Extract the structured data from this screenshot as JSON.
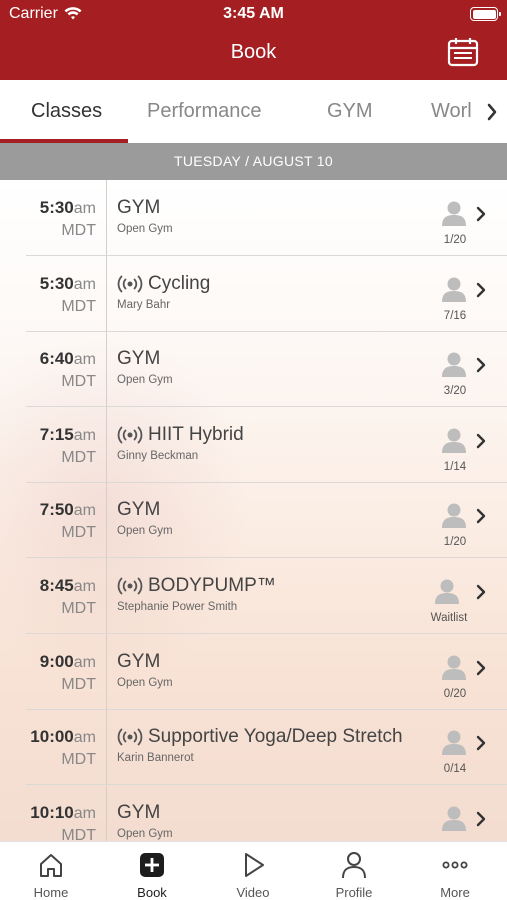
{
  "status": {
    "carrier": "Carrier",
    "time": "3:45 AM"
  },
  "header": {
    "title": "Book"
  },
  "tabs": [
    {
      "label": "Classes",
      "active": true
    },
    {
      "label": "Performance"
    },
    {
      "label": "GYM"
    },
    {
      "label": "Worl"
    }
  ],
  "date": "TUESDAY / AUGUST 10",
  "classes": [
    {
      "time": "5:30",
      "ampm": "am",
      "tz": "MDT",
      "name": "GYM",
      "sub": "Open Gym",
      "live": false,
      "count": "1/20"
    },
    {
      "time": "5:30",
      "ampm": "am",
      "tz": "MDT",
      "name": "Cycling",
      "sub": "Mary Bahr",
      "live": true,
      "count": "7/16"
    },
    {
      "time": "6:40",
      "ampm": "am",
      "tz": "MDT",
      "name": "GYM",
      "sub": "Open Gym",
      "live": false,
      "count": "3/20"
    },
    {
      "time": "7:15",
      "ampm": "am",
      "tz": "MDT",
      "name": "HIIT Hybrid",
      "sub": "Ginny Beckman",
      "live": true,
      "count": "1/14"
    },
    {
      "time": "7:50",
      "ampm": "am",
      "tz": "MDT",
      "name": "GYM",
      "sub": "Open Gym",
      "live": false,
      "count": "1/20"
    },
    {
      "time": "8:45",
      "ampm": "am",
      "tz": "MDT",
      "name": "BODYPUMP™",
      "sub": "Stephanie Power Smith",
      "live": true,
      "count": "Waitlist"
    },
    {
      "time": "9:00",
      "ampm": "am",
      "tz": "MDT",
      "name": "GYM",
      "sub": "Open Gym",
      "live": false,
      "count": "0/20"
    },
    {
      "time": "10:00",
      "ampm": "am",
      "tz": "MDT",
      "name": "Supportive Yoga/Deep Stretch",
      "sub": "Karin Bannerot",
      "live": true,
      "count": "0/14"
    },
    {
      "time": "10:10",
      "ampm": "am",
      "tz": "MDT",
      "name": "GYM",
      "sub": "Open Gym",
      "live": false,
      "count": ""
    }
  ],
  "bottom_nav": [
    {
      "label": "Home",
      "icon": "home-icon"
    },
    {
      "label": "Book",
      "icon": "plus-square-icon",
      "active": true
    },
    {
      "label": "Video",
      "icon": "play-icon"
    },
    {
      "label": "Profile",
      "icon": "profile-icon"
    },
    {
      "label": "More",
      "icon": "more-icon"
    }
  ],
  "colors": {
    "brand": "#a41e22",
    "date_bar": "#9b9b9b"
  }
}
